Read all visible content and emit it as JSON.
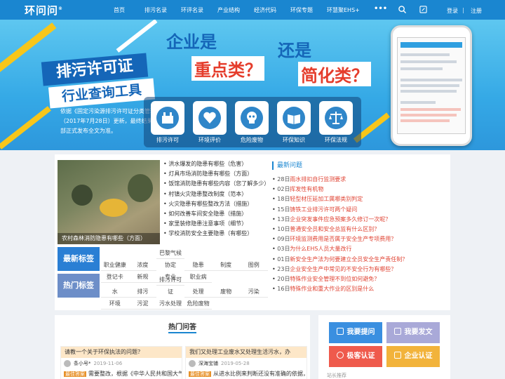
{
  "nav": {
    "logo": "环问问",
    "logo_mark": "®",
    "links": [
      "首页",
      "排污名录",
      "环评名录",
      "产业结构",
      "经济代码",
      "环保专题",
      "环慧聚EHS+"
    ],
    "more": "•••",
    "login": "登录",
    "sep": "|",
    "register": "注册",
    "icons": [
      "search-icon",
      "edit-icon"
    ]
  },
  "banner": {
    "headline1": "企业是",
    "headline2": "重点类？",
    "headline3": "还是",
    "headline4": "简化类？",
    "plate1": "排污许可证",
    "plate2": "行业查询工具",
    "desc": "依据《固定污染源排污许可证分类管理名录（2017年7月28日）更新，最终结果以环境部正式发布全文为准。",
    "tools": [
      {
        "label": "排污许可",
        "icon": "factory-icon"
      },
      {
        "label": "环境评价",
        "icon": "heart-hand-icon"
      },
      {
        "label": "危险废物",
        "icon": "skull-icon"
      },
      {
        "label": "环保知识",
        "icon": "book-icon"
      },
      {
        "label": "环保法规",
        "icon": "scale-icon"
      }
    ],
    "colors": {
      "sky": "#35a9e6",
      "headline": "#1566b8",
      "accent": "#e53d2c",
      "stripe": "#f7c61a"
    }
  },
  "hazards": {
    "photo_caption": "农村森林消防隐患有哪些（方面）",
    "items": [
      "洪水爆发的隐患有哪些（危害）",
      "灯具市场消防隐患有哪些（方面）",
      "饭馆消防隐患有哪些内容（您了解多少）",
      "村镇火灾隐患整改制度（范本）",
      "火灾隐患有哪些整改方法（措施）",
      "如何改善车间安全隐患（措施）",
      "家里装修隐患注意事项（细节）",
      "学校消防安全主要隐患（有哪些）"
    ]
  },
  "tags": {
    "newest_label": "最新标签",
    "hot_label": "热门标签",
    "newest": [
      "职业健康",
      "浓度",
      "巴黎气候协定",
      "隐患",
      "制度",
      "图例",
      "登记卡",
      "新规",
      "专业",
      "职业病"
    ],
    "hot": [
      "水",
      "排污",
      "排污许可证",
      "处理",
      "废物",
      "污染",
      "环境",
      "污泥",
      "污水处理",
      "危险废物"
    ],
    "colors": {
      "newest": "#2a7fd4",
      "hot": "#6d8ec8"
    }
  },
  "latest": {
    "title": "最新问题",
    "items": [
      {
        "date": "28日",
        "title": "雨水排扣自行监测要求"
      },
      {
        "date": "02日",
        "title": "挥发性有机物"
      },
      {
        "date": "18日",
        "title": "轻型材压延加工属哪类别判定"
      },
      {
        "date": "15日",
        "title": "铸铁工业排污许可两个疑问"
      },
      {
        "date": "13日",
        "title": "企业突发事件应急预案多久修订一次呢？"
      },
      {
        "date": "10日",
        "title": "普通安全员和安全总监有什么区别？"
      },
      {
        "date": "09日",
        "title": "环境监测费用是否属于安全生产专项费用？"
      },
      {
        "date": "03日",
        "title": "为什么EHS人员大量改行"
      },
      {
        "date": "01日",
        "title": "新安全生产法为何要建立全员安全生产责任制？"
      },
      {
        "date": "23日",
        "title": "企业安全生产中常见的不安全行为有哪些？"
      },
      {
        "date": "20日",
        "title": "特殊作业安全管理不到位如何避免？"
      },
      {
        "date": "16日",
        "title": "特殊作业和重大作业的区别是什么"
      }
    ]
  },
  "hot_qa": {
    "title": "热门问答",
    "cards": [
      {
        "question": "请教一个关于环保执法的问题？",
        "user": "条小号*",
        "date": "2019-11-06",
        "badge": "最佳答案",
        "answer": "需要整改，根据《中华人民共和国大气污染"
      },
      {
        "question": "我们又处理工业废水又处理生活污水，办",
        "user": "深海宝铺",
        "date": "2019-05-28",
        "badge": "最佳答案",
        "answer": "从进水比例来判断还没有准确的依据，建议"
      }
    ]
  },
  "side": {
    "buttons": [
      {
        "label": "我要提问",
        "color": "#3a8fe0",
        "icon": "question-icon"
      },
      {
        "label": "我要发文",
        "color": "#a9a9d8",
        "icon": "pen-icon"
      },
      {
        "label": "极客认证",
        "color": "#ef5a4c",
        "icon": "user-icon"
      },
      {
        "label": "企业认证",
        "color": "#f2b33b",
        "icon": "building-icon"
      }
    ],
    "footer": "站长推荐"
  }
}
